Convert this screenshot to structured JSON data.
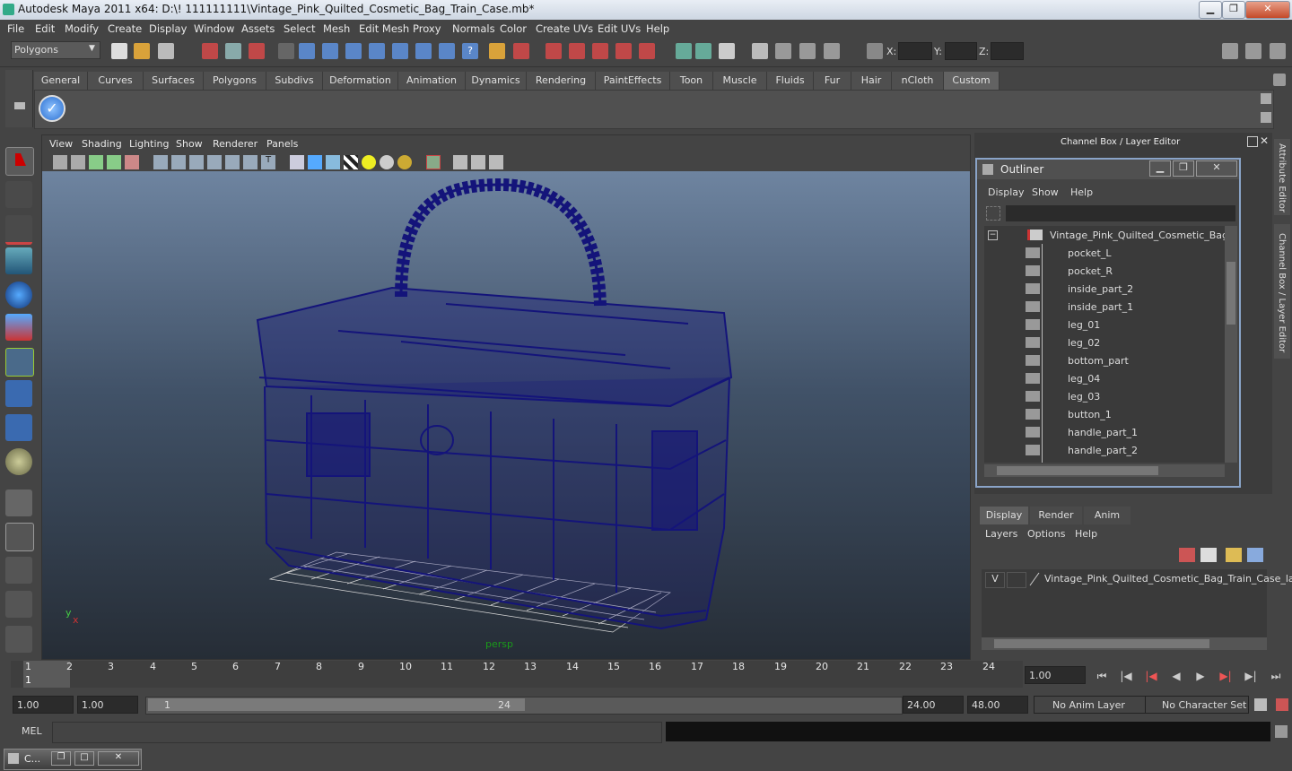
{
  "app": {
    "title": "Autodesk Maya 2011 x64: D:\\! 111111111\\Vintage_Pink_Quilted_Cosmetic_Bag_Train_Case.mb*"
  },
  "menubar": [
    "File",
    "Edit",
    "Modify",
    "Create",
    "Display",
    "Window",
    "Assets",
    "Select",
    "Mesh",
    "Edit Mesh",
    "Proxy",
    "Normals",
    "Color",
    "Create UVs",
    "Edit UVs",
    "Help"
  ],
  "statusline": {
    "mode": "Polygons",
    "x_label": "X:",
    "y_label": "Y:",
    "z_label": "Z:"
  },
  "shelf": {
    "tabs": [
      "General",
      "Curves",
      "Surfaces",
      "Polygons",
      "Subdivs",
      "Deformation",
      "Animation",
      "Dynamics",
      "Rendering",
      "PaintEffects",
      "Toon",
      "Muscle",
      "Fluids",
      "Fur",
      "Hair",
      "nCloth",
      "Custom"
    ],
    "active_tab": "Custom"
  },
  "viewport": {
    "menu": [
      "View",
      "Shading",
      "Lighting",
      "Show",
      "Renderer",
      "Panels"
    ],
    "camera_label": "persp",
    "wire_color": "#14147a"
  },
  "channel_box": {
    "title": "Channel Box / Layer Editor",
    "side_tabs": [
      "Attribute Editor",
      "Channel Box / Layer Editor"
    ]
  },
  "outliner": {
    "title": "Outliner",
    "menu": [
      "Display",
      "Show",
      "Help"
    ],
    "root": "Vintage_Pink_Quilted_Cosmetic_Bag_Tra",
    "items": [
      "pocket_L",
      "pocket_R",
      "inside_part_2",
      "inside_part_1",
      "leg_01",
      "leg_02",
      "bottom_part",
      "leg_04",
      "leg_03",
      "button_1",
      "handle_part_1",
      "handle_part_2"
    ]
  },
  "layer_editor": {
    "tabs": [
      "Display",
      "Render",
      "Anim"
    ],
    "active_tab": "Display",
    "menu": [
      "Layers",
      "Options",
      "Help"
    ],
    "layer": {
      "visibility": "V",
      "name": "Vintage_Pink_Quilted_Cosmetic_Bag_Train_Case_la"
    }
  },
  "timeline": {
    "ticks": [
      "1",
      "2",
      "3",
      "4",
      "5",
      "6",
      "7",
      "8",
      "9",
      "10",
      "11",
      "12",
      "13",
      "14",
      "15",
      "16",
      "17",
      "18",
      "19",
      "20",
      "21",
      "22",
      "23",
      "24"
    ],
    "current_frame_marker": "1",
    "current_time": "1.00"
  },
  "range": {
    "start_time": "1.00",
    "playback_start": "1.00",
    "slider_start": "1",
    "slider_end": "24",
    "playback_end": "24.00",
    "end_time": "48.00",
    "anim_layer": "No Anim Layer",
    "character_set": "No Character Set"
  },
  "command_line": {
    "label": "MEL"
  },
  "minimized_window": {
    "label": "C..."
  },
  "colors": {
    "accent": "#8aa4c8",
    "ui_background": "#444444"
  }
}
